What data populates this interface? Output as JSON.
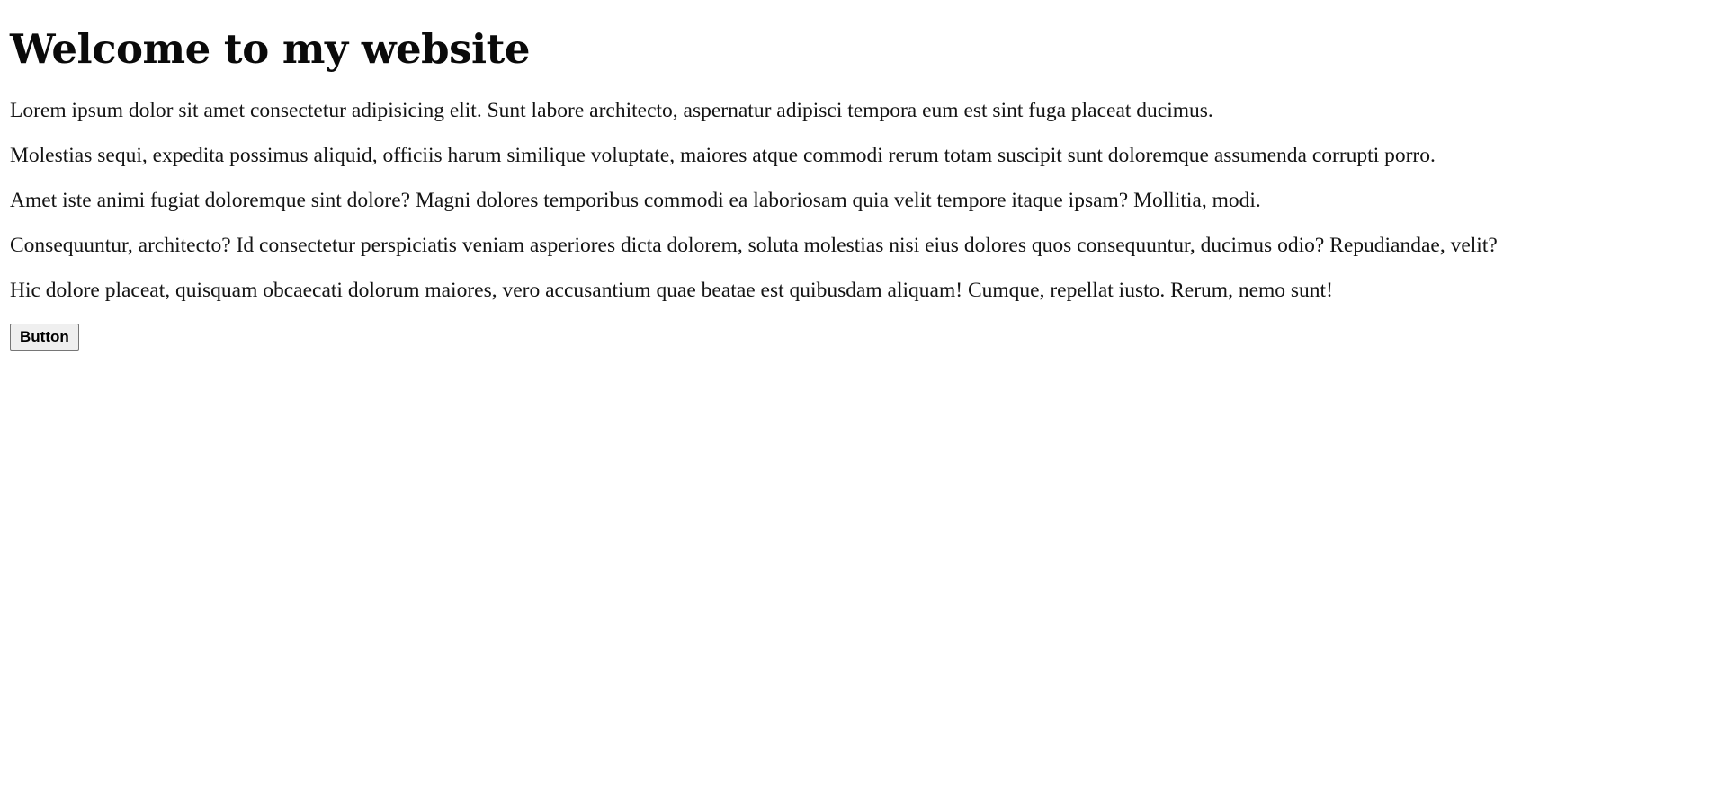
{
  "page": {
    "heading": "Welcome to my website",
    "paragraphs": [
      "Lorem ipsum dolor sit amet consectetur adipisicing elit. Sunt labore architecto, aspernatur adipisci tempora eum est sint fuga placeat ducimus.",
      "Molestias sequi, expedita possimus aliquid, officiis harum similique voluptate, maiores atque commodi rerum totam suscipit sunt doloremque assumenda corrupti porro.",
      "Amet iste animi fugiat doloremque sint dolore? Magni dolores temporibus commodi ea laboriosam quia velit tempore itaque ipsam? Mollitia, modi.",
      "Consequuntur, architecto? Id consectetur perspiciatis veniam asperiores dicta dolorem, soluta molestias nisi eius dolores quos consequuntur, ducimus odio? Repudiandae, velit?",
      "Hic dolore placeat, quisquam obcaecati dolorum maiores, vero accusantium quae beatae est quibusdam aliquam! Cumque, repellat iusto. Rerum, nemo sunt!"
    ],
    "button_label": "Button"
  }
}
